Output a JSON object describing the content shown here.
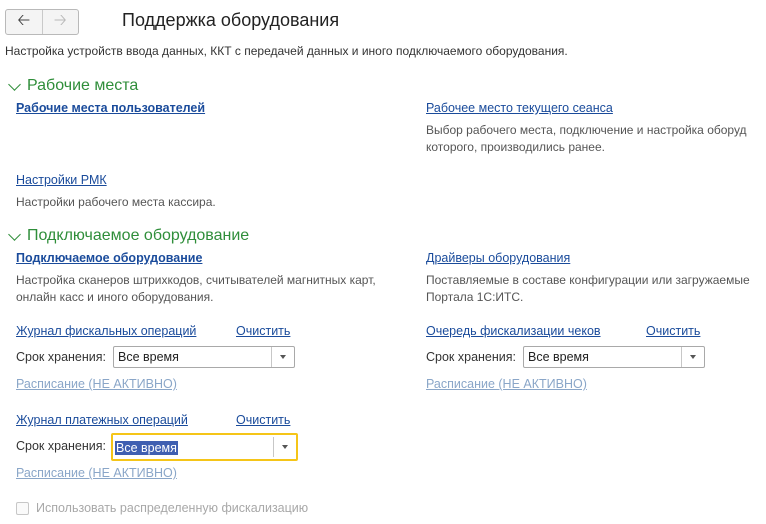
{
  "header": {
    "back_icon": "arrow-left-icon",
    "forward_icon": "arrow-right-icon",
    "title": "Поддержка оборудования",
    "subtitle": "Настройка устройств ввода данных, ККТ с передачей данных и иного подключаемого оборудования."
  },
  "workplaces": {
    "title": "Рабочие места",
    "user_workplaces_link": "Рабочие места пользователей",
    "current_session_link": "Рабочее место текущего сеанса",
    "current_session_desc_line1": "Выбор рабочего места, подключение и настройка оборуд",
    "current_session_desc_line2": "которого, производились ранее.",
    "rmk_settings_link": "Настройки РМК",
    "rmk_settings_desc": "Настройки рабочего места кассира."
  },
  "equipment": {
    "title": "Подключаемое оборудование",
    "connected_link": "Подключаемое оборудование",
    "connected_desc_line1": "Настройка сканеров штрихкодов, считывателей магнитных карт,",
    "connected_desc_line2": "онлайн касс и иного оборудования.",
    "drivers_link": "Драйверы оборудования",
    "drivers_desc_line1": "Поставляемые в составе конфигурации или загружаемые",
    "drivers_desc_line2": "Портала 1С:ИТС."
  },
  "fiscal_log": {
    "link": "Журнал фискальных операций",
    "clear": "Очистить",
    "retention_label": "Срок хранения:",
    "retention_value": "Все время",
    "schedule": "Расписание (НЕ АКТИВНО)"
  },
  "fiscal_queue": {
    "link": "Очередь фискализации чеков",
    "clear": "Очистить",
    "retention_label": "Срок хранения:",
    "retention_value": "Все время",
    "schedule": "Расписание (НЕ АКТИВНО)"
  },
  "payment_log": {
    "link": "Журнал платежных операций",
    "clear": "Очистить",
    "retention_label": "Срок хранения:",
    "retention_value": "Все время",
    "schedule": "Расписание (НЕ АКТИВНО)"
  },
  "distributed": {
    "label": "Использовать распределенную фискализацию",
    "checked": false
  },
  "colors": {
    "section_green": "#2f8e3a",
    "link_blue": "#1a4b9b",
    "focus_yellow": "#f5c518",
    "selection_blue": "#3f5fb1"
  }
}
